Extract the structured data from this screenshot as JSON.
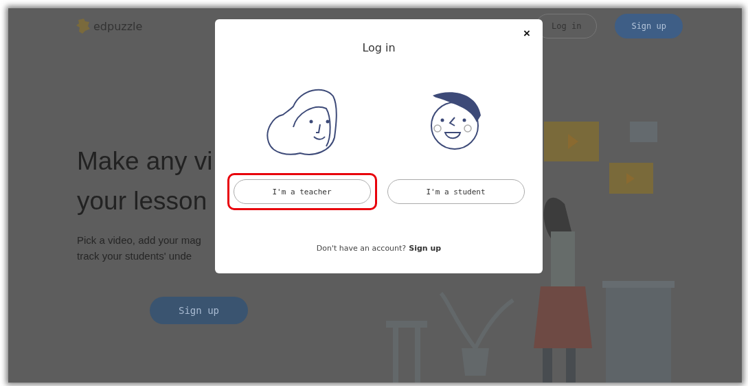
{
  "header": {
    "logo_text": "edpuzzle",
    "buttons": [
      {
        "label": "Log in",
        "kind": "outline"
      },
      {
        "label": "Sign up",
        "kind": "filled"
      }
    ]
  },
  "hero": {
    "heading_lines": [
      "Make any vi",
      "your lesson"
    ],
    "text_lines": [
      "Pick a video, add your mag",
      "track your students' unde"
    ],
    "button": "Sign up"
  },
  "modal": {
    "title": "Log in",
    "close": "×",
    "options": [
      {
        "label": "I'm a teacher",
        "kind": "teacher",
        "highlighted": true
      },
      {
        "label": "I'm a student",
        "kind": "student",
        "highlighted": false
      }
    ],
    "footer_text": "Don't have an account?",
    "footer_link": "Sign up"
  }
}
